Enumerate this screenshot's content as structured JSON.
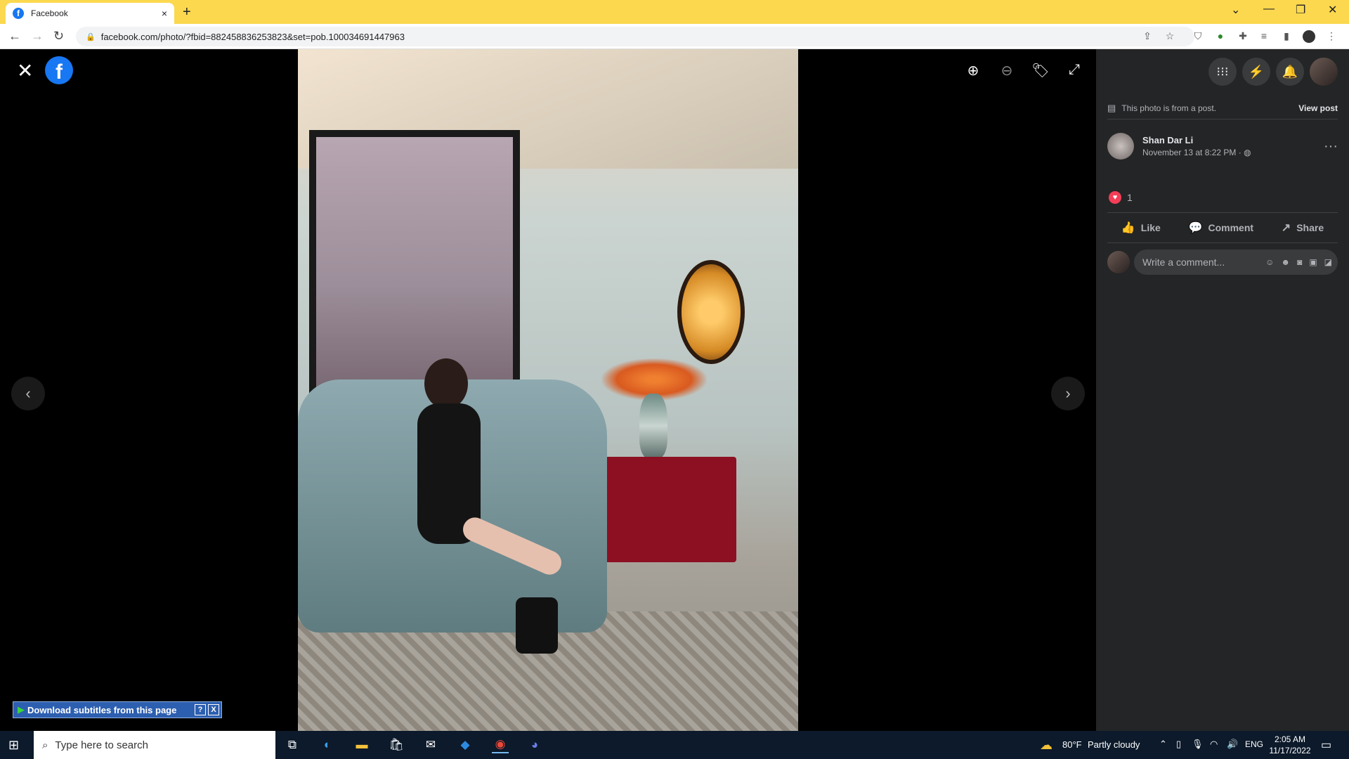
{
  "browser": {
    "tab_title": "Facebook",
    "tab_close": "×",
    "new_tab": "+",
    "url": "facebook.com/photo/?fbid=882458836253823&set=pob.100034691447963",
    "window_controls": [
      "⌄",
      "—",
      "❐",
      "✕"
    ]
  },
  "viewer": {
    "close_icon": "✕",
    "logo_letter": "f",
    "controls": [
      "zoom-in-icon",
      "zoom-out-icon",
      "tag-icon",
      "fullscreen-icon"
    ],
    "prev_arrow": "‹",
    "next_arrow": "›"
  },
  "subtitles_bar": {
    "label": "Download subtitles from this page",
    "help": "?",
    "close": "X"
  },
  "panel": {
    "post_note": "This photo is from a post.",
    "view_post": "View post",
    "author_name": "Shan Dar Li",
    "post_date": "November 13 at 8:22 PM · ◍",
    "more": "···",
    "reaction_count": "1",
    "actions": {
      "like": "Like",
      "comment": "Comment",
      "share": "Share"
    },
    "comment_placeholder": "Write a comment..."
  },
  "taskbar": {
    "search_placeholder": "Type here to search",
    "weather_temp": "80°F",
    "weather_desc": "Partly cloudy",
    "language": "ENG",
    "time": "2:05 AM",
    "date": "11/17/2022"
  },
  "colors": {
    "chrome_accent": "#fbd84e",
    "fb_blue": "#1877f2",
    "panel_bg": "#242526",
    "heart": "#f33e58"
  }
}
